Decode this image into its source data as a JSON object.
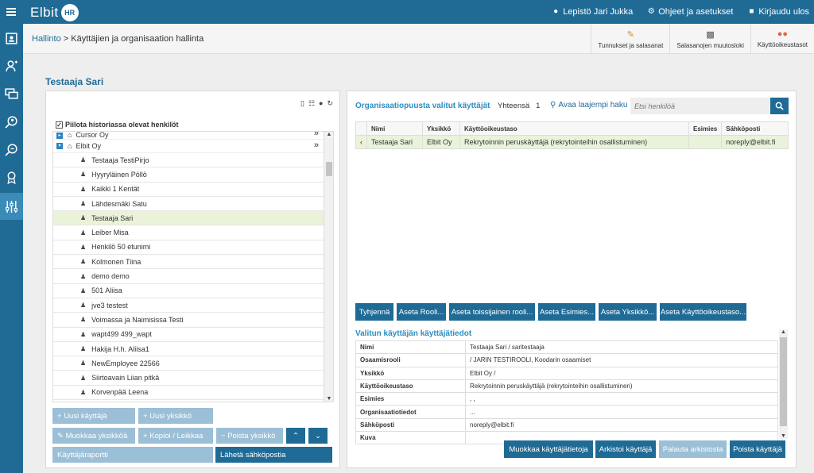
{
  "app": {
    "logo_text": "Elbit",
    "logo_badge": "HR"
  },
  "topnav": {
    "user": "Lepistö Jari Jukka",
    "help": "Ohjeet ja asetukset",
    "logout": "Kirjaudu ulos"
  },
  "breadcrumb": {
    "root": "Hallinto",
    "sep": ">",
    "current": "Käyttäjien ja organisaation hallinta"
  },
  "toolbar": {
    "credentials": "Tunnukset ja salasanat",
    "pwlog": "Salasanojen muutosloki",
    "access": "Käyttöoikeustasot"
  },
  "page_title": "Testaaja Sari",
  "left": {
    "hide_history": "Piilota historiassa olevat henkilöt",
    "orgs": [
      "Cursor Oy",
      "Elbit Oy"
    ],
    "more": "»",
    "persons": [
      "Testaaja TestiPirjo",
      "Hyyryläinen Pöllö",
      "Kaikki 1 Kentät",
      "Lähdesmäki Satu",
      "Testaaja Sari",
      "Leiber Misa",
      "Henkilö 50 etunimi",
      "Kolmonen Tiina",
      "demo demo",
      "501 Aliisa",
      "jve3 testest",
      "Voimassa ja Naimisissa Testi",
      "wapt499 499_wapt",
      "Hakija H.h. Aliisa1",
      "NewEmployee 22566",
      "Siirtoavain Liian pitkä",
      "Korvenpää Leena"
    ],
    "buttons": {
      "new_user": "Uusi käyttäjä",
      "new_unit": "Uusi yksikkö",
      "edit_unit": "Muokkaa yksikköä",
      "copy_cut": "Kopioi / Leikkaa",
      "delete_unit": "Poista yksikkö",
      "user_report": "Käyttäjäraportti",
      "send_email": "Lähetä sähköpostia"
    }
  },
  "right": {
    "title": "Organisaatiopuusta valitut käyttäjät",
    "total_label": "Yhteensä",
    "total_value": "1",
    "extended": "Avaa laajempi haku",
    "search_placeholder": "Etsi henkilöä",
    "columns": [
      "Nimi",
      "Yksikkö",
      "Käyttöoikeustaso",
      "Esimies",
      "Sähköposti"
    ],
    "rows": [
      {
        "arrow": "‹",
        "name": "Testaaja Sari",
        "unit": "Elbit Oy",
        "level": "Rekrytoinnin peruskäyttäjä (rekrytointeihin osallistuminen)",
        "boss": "",
        "email": "noreply@elbit.fi"
      }
    ],
    "actions": [
      "Tyhjennä",
      "Aseta Rooli...",
      "Aseta toissijainen rooli...",
      "Aseta Esimies...",
      "Aseta Yksikkö...",
      "Aseta Käyttöoikeustaso..."
    ],
    "details_title": "Valitun käyttäjän käyttäjätiedot",
    "details": [
      {
        "k": "Nimi",
        "v": "Testaaja Sari / saritestaaja"
      },
      {
        "k": "Osaamisrooli",
        "v": " / JARIN TESTIROOLI, Koodarin osaamiset"
      },
      {
        "k": "Yksikkö",
        "v": "Elbit Oy /"
      },
      {
        "k": "Käyttöoikeustaso",
        "v": "Rekrytoinnin peruskäyttäjä (rekrytointeihin osallistuminen)"
      },
      {
        "k": "Esimies",
        "v": ", ,"
      },
      {
        "k": "Organisaatiotiedot",
        "v": "..."
      },
      {
        "k": "Sähköposti",
        "v": "noreply@elbit.fi"
      },
      {
        "k": "Kuva",
        "v": ""
      }
    ],
    "bottom": {
      "edit": "Muokkaa käyttäjätietoja",
      "archive": "Arkistoi käyttäjä",
      "restore": "Palauta arkistosta",
      "delete": "Poista käyttäjä"
    }
  }
}
